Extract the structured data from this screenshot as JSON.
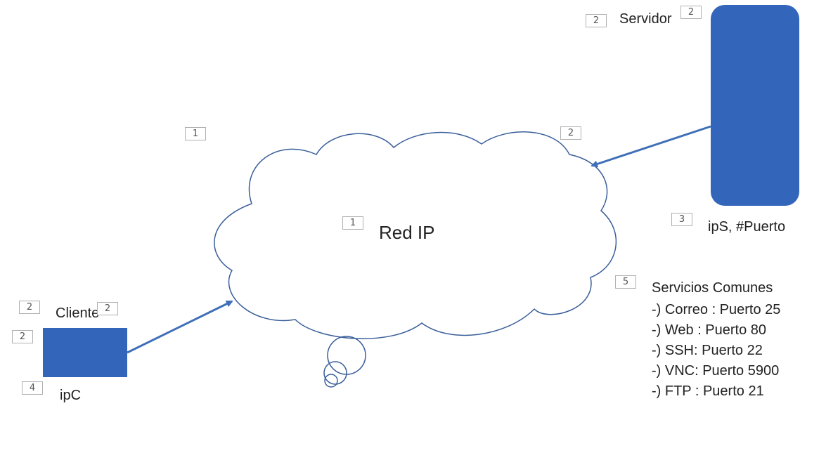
{
  "network": {
    "label": "Red IP"
  },
  "server": {
    "label": "Servidor",
    "address": "ipS, #Puerto",
    "color": "#3366bb"
  },
  "client": {
    "label": "Cliente",
    "address": "ipC",
    "color": "#3366bb"
  },
  "services": {
    "title": "Servicios Comunes",
    "items": [
      "-) Correo : Puerto 25",
      "-) Web : Puerto 80",
      "-) SSH: Puerto 22",
      "-) VNC: Puerto 5900",
      "-) FTP : Puerto 21"
    ]
  },
  "badges": {
    "server_left": "2",
    "server_right": "2",
    "server_address": "3",
    "cloud_top_left": "1",
    "cloud_top_right": "2",
    "cloud_center": "1",
    "services": "5",
    "client_label_left": "2",
    "client_label_right": "2",
    "client_box": "2",
    "client_address": "4"
  },
  "colors": {
    "arrow": "#3f6fb8",
    "cloud_stroke": "#3a5f9a",
    "node_fill": "#3366bb"
  }
}
